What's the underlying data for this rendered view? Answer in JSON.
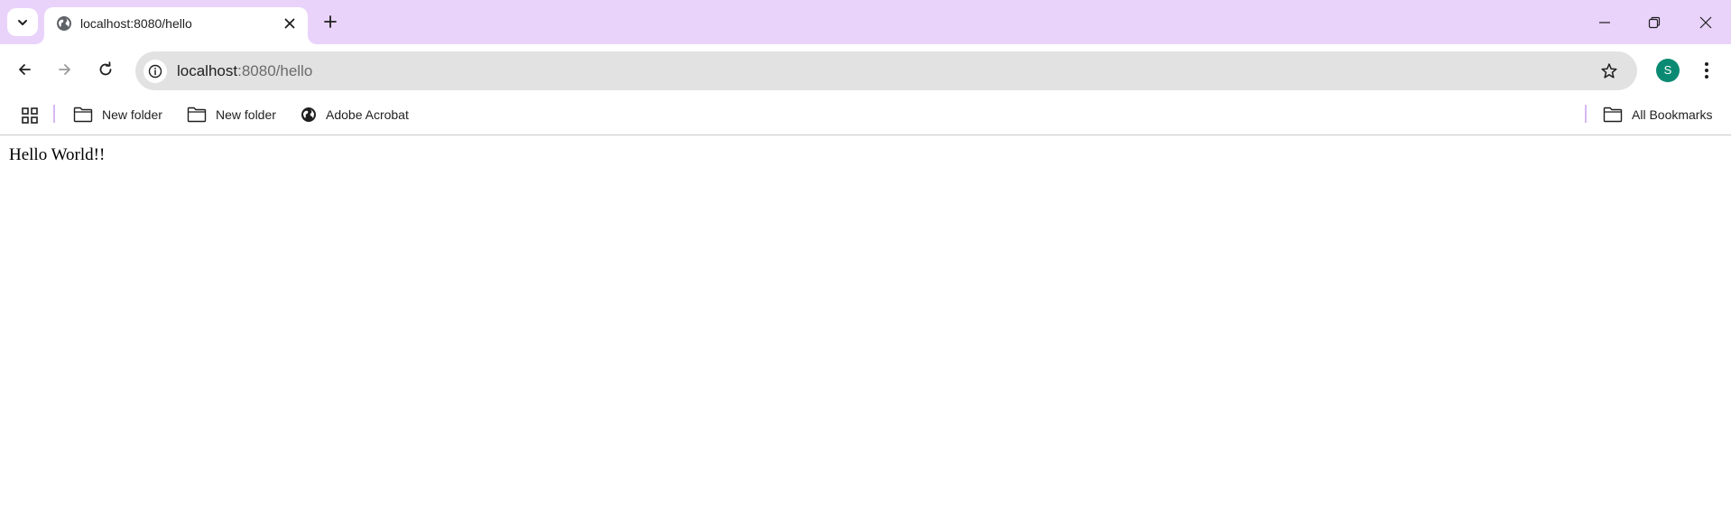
{
  "browser": {
    "tab": {
      "title": "localhost:8080/hello",
      "favicon": "globe-icon"
    },
    "url": {
      "host": "localhost",
      "rest": ":8080/hello"
    },
    "profile_initial": "S",
    "accent_color": "#e9d3fb",
    "profile_color": "#0b8a73"
  },
  "bookmarks_bar": {
    "items": [
      {
        "label": "New folder",
        "icon": "folder-icon"
      },
      {
        "label": "New folder",
        "icon": "folder-icon"
      },
      {
        "label": "Adobe Acrobat",
        "icon": "globe-icon"
      }
    ],
    "all_bookmarks_label": "All Bookmarks"
  },
  "page": {
    "text": "Hello World!!"
  }
}
